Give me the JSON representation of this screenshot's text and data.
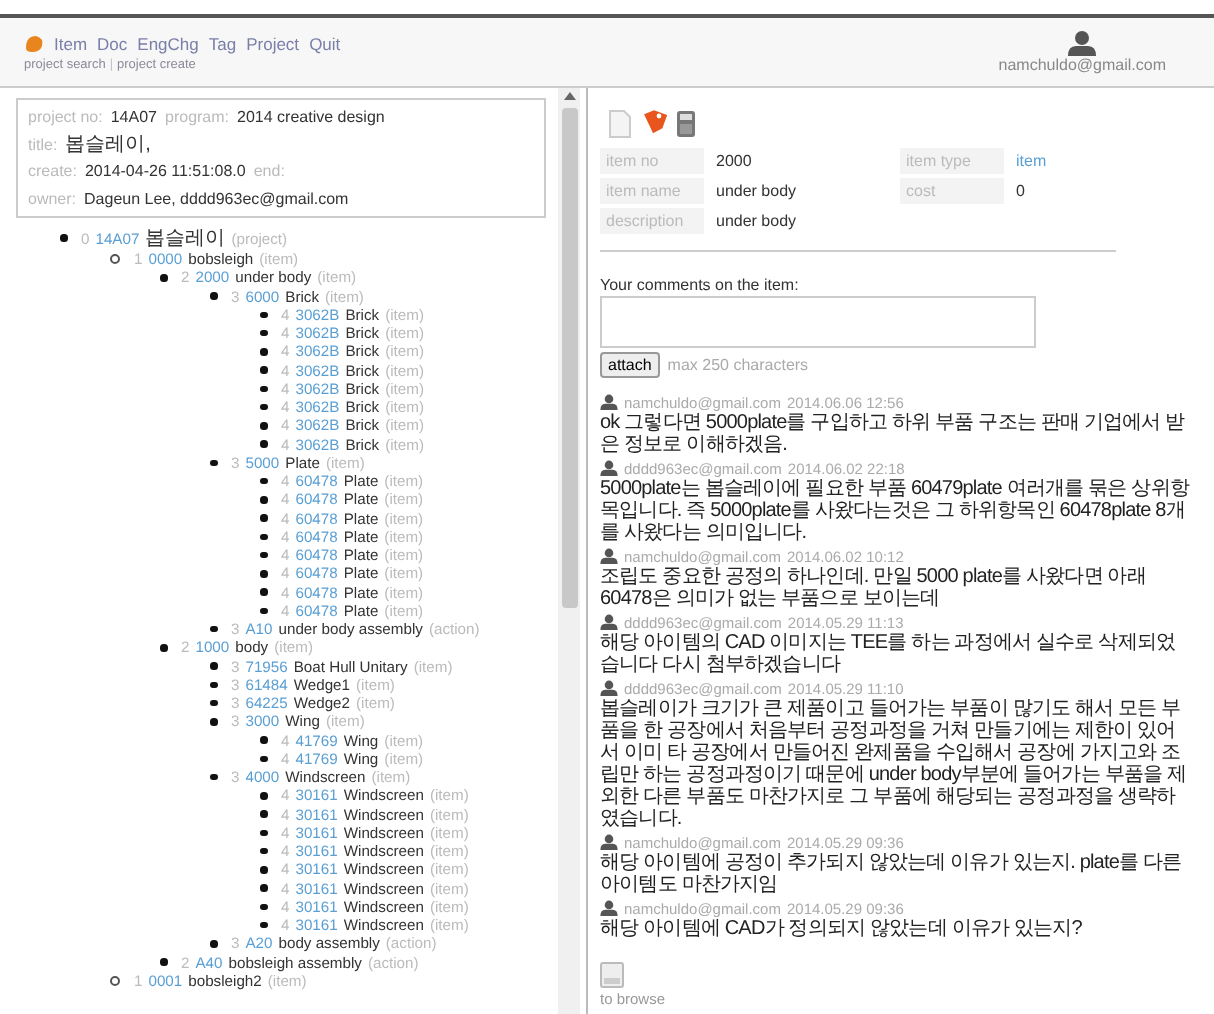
{
  "header": {
    "menu": [
      "Item",
      "Doc",
      "EngChg",
      "Tag",
      "Project",
      "Quit"
    ],
    "sub_links": [
      {
        "kind": "link",
        "text": "project search"
      },
      {
        "kind": "separator",
        "text": "|"
      },
      {
        "kind": "link",
        "text": "project create"
      }
    ],
    "user": "namchuldo@gmail.com"
  },
  "project_info": [
    [
      {
        "label": "project no:",
        "value": "14A07"
      },
      {
        "label": "program:",
        "value": "2014 creative design"
      }
    ],
    [
      {
        "label": "title:",
        "value": "봅슬레이,"
      }
    ],
    [
      {
        "label": "create:",
        "value": "2014-04-26 11:51:08.0"
      },
      {
        "label": "end:"
      }
    ],
    [
      {
        "label": "owner:",
        "value": "Dageun Lee, dddd963ec@gmail.com"
      }
    ]
  ],
  "tree": [
    {
      "level": "0",
      "code": "14A07",
      "name": "봅슬레이",
      "type": "(project)",
      "children": [
        {
          "level": "1",
          "code": "0000",
          "name": "bobsleigh",
          "type": "(item)",
          "children": [
            {
              "level": "2",
              "code": "2000",
              "name": "under body",
              "type": "(item)",
              "children": [
                {
                  "level": "3",
                  "code": "6000",
                  "name": "Brick",
                  "type": "(item)",
                  "children": [
                    {
                      "level": "4",
                      "code": "3062B",
                      "name": "Brick",
                      "type": "(item)"
                    },
                    {
                      "level": "4",
                      "code": "3062B",
                      "name": "Brick",
                      "type": "(item)"
                    },
                    {
                      "level": "4",
                      "code": "3062B",
                      "name": "Brick",
                      "type": "(item)"
                    },
                    {
                      "level": "4",
                      "code": "3062B",
                      "name": "Brick",
                      "type": "(item)"
                    },
                    {
                      "level": "4",
                      "code": "3062B",
                      "name": "Brick",
                      "type": "(item)"
                    },
                    {
                      "level": "4",
                      "code": "3062B",
                      "name": "Brick",
                      "type": "(item)"
                    },
                    {
                      "level": "4",
                      "code": "3062B",
                      "name": "Brick",
                      "type": "(item)"
                    },
                    {
                      "level": "4",
                      "code": "3062B",
                      "name": "Brick",
                      "type": "(item)"
                    }
                  ]
                },
                {
                  "level": "3",
                  "code": "5000",
                  "name": "Plate",
                  "type": "(item)",
                  "children": [
                    {
                      "level": "4",
                      "code": "60478",
                      "name": "Plate",
                      "type": "(item)"
                    },
                    {
                      "level": "4",
                      "code": "60478",
                      "name": "Plate",
                      "type": "(item)"
                    },
                    {
                      "level": "4",
                      "code": "60478",
                      "name": "Plate",
                      "type": "(item)"
                    },
                    {
                      "level": "4",
                      "code": "60478",
                      "name": "Plate",
                      "type": "(item)"
                    },
                    {
                      "level": "4",
                      "code": "60478",
                      "name": "Plate",
                      "type": "(item)"
                    },
                    {
                      "level": "4",
                      "code": "60478",
                      "name": "Plate",
                      "type": "(item)"
                    },
                    {
                      "level": "4",
                      "code": "60478",
                      "name": "Plate",
                      "type": "(item)"
                    },
                    {
                      "level": "4",
                      "code": "60478",
                      "name": "Plate",
                      "type": "(item)"
                    }
                  ]
                },
                {
                  "level": "3",
                  "code": "A10",
                  "name": "under body assembly",
                  "type": "(action)"
                }
              ]
            },
            {
              "level": "2",
              "code": "1000",
              "name": "body",
              "type": "(item)",
              "children": [
                {
                  "level": "3",
                  "code": "71956",
                  "name": "Boat Hull Unitary",
                  "type": "(item)"
                },
                {
                  "level": "3",
                  "code": "61484",
                  "name": "Wedge1",
                  "type": "(item)"
                },
                {
                  "level": "3",
                  "code": "64225",
                  "name": "Wedge2",
                  "type": "(item)"
                },
                {
                  "level": "3",
                  "code": "3000",
                  "name": "Wing",
                  "type": "(item)",
                  "children": [
                    {
                      "level": "4",
                      "code": "41769",
                      "name": "Wing",
                      "type": "(item)"
                    },
                    {
                      "level": "4",
                      "code": "41769",
                      "name": "Wing",
                      "type": "(item)"
                    }
                  ]
                },
                {
                  "level": "3",
                  "code": "4000",
                  "name": "Windscreen",
                  "type": "(item)",
                  "children": [
                    {
                      "level": "4",
                      "code": "30161",
                      "name": "Windscreen",
                      "type": "(item)"
                    },
                    {
                      "level": "4",
                      "code": "30161",
                      "name": "Windscreen",
                      "type": "(item)"
                    },
                    {
                      "level": "4",
                      "code": "30161",
                      "name": "Windscreen",
                      "type": "(item)"
                    },
                    {
                      "level": "4",
                      "code": "30161",
                      "name": "Windscreen",
                      "type": "(item)"
                    },
                    {
                      "level": "4",
                      "code": "30161",
                      "name": "Windscreen",
                      "type": "(item)"
                    },
                    {
                      "level": "4",
                      "code": "30161",
                      "name": "Windscreen",
                      "type": "(item)"
                    },
                    {
                      "level": "4",
                      "code": "30161",
                      "name": "Windscreen",
                      "type": "(item)"
                    },
                    {
                      "level": "4",
                      "code": "30161",
                      "name": "Windscreen",
                      "type": "(item)"
                    }
                  ]
                },
                {
                  "level": "3",
                  "code": "A20",
                  "name": "body assembly",
                  "type": "(action)"
                }
              ]
            },
            {
              "level": "2",
              "code": "A40",
              "name": "bobsleigh assembly",
              "type": "(action)"
            }
          ]
        },
        {
          "level": "1",
          "code": "0001",
          "name": "bobsleigh2",
          "type": "(item)"
        }
      ]
    }
  ],
  "item": {
    "fields_left": [
      {
        "label": "item no",
        "value": "2000",
        "link": false
      },
      {
        "label": "item name",
        "value": "under body",
        "link": false
      },
      {
        "label": "description",
        "value": "under body",
        "link": false
      }
    ],
    "fields_right": [
      {
        "label": "item type",
        "value": "item",
        "link": true
      },
      {
        "label": "cost",
        "value": "0",
        "link": false
      }
    ]
  },
  "comment_form": {
    "label": "Your comments on the item:",
    "button": "attach",
    "hint": "max 250 characters"
  },
  "comments": [
    {
      "author": "namchuldo@gmail.com",
      "time": "2014.06.06 12:56",
      "text": "ok 그렇다면 5000plate를 구입하고 하위 부품 구조는 판매 기업에서 받은 정보로 이해하겠음."
    },
    {
      "author": "dddd963ec@gmail.com",
      "time": "2014.06.02 22:18",
      "text": "5000plate는 봅슬레이에 필요한 부품 60479plate 여러개를 묶은 상위항목입니다. 즉 5000plate를 사왔다는것은 그 하위항목인 60478plate 8개를 사왔다는 의미입니다."
    },
    {
      "author": "namchuldo@gmail.com",
      "time": "2014.06.02 10:12",
      "text": "조립도 중요한 공정의 하나인데. 만일 5000 plate를 사왔다면 아래 60478은 의미가 없는 부품으로 보이는데"
    },
    {
      "author": "dddd963ec@gmail.com",
      "time": "2014.05.29 11:13",
      "text": "해당 아이템의 CAD 이미지는 TEE를 하는 과정에서 실수로 삭제되었습니다 다시 첨부하겠습니다"
    },
    {
      "author": "dddd963ec@gmail.com",
      "time": "2014.05.29 11:10",
      "text": "봅슬레이가 크기가 큰 제품이고 들어가는 부품이 많기도 해서 모든 부품을 한 공장에서 처음부터 공정과정을 거쳐 만들기에는 제한이 있어서 이미 타 공장에서 만들어진 완제품을 수입해서 공장에 가지고와 조립만 하는 공정과정이기 때문에 under body부분에 들어가는 부품을 제외한 다른 부품도 마찬가지로 그 부품에 해당되는 공정과정을 생략하였습니다."
    },
    {
      "author": "namchuldo@gmail.com",
      "time": "2014.05.29 09:36",
      "text": "해당 아이템에 공정이 추가되지 않았는데 이유가 있는지. plate를 다른 아이템도 마찬가지임"
    },
    {
      "author": "namchuldo@gmail.com",
      "time": "2014.05.29 09:36",
      "text": "해당 아이템에 CAD가 정의되지 않았는데 이유가 있는지?"
    }
  ],
  "upload": {
    "label": "to browse"
  }
}
